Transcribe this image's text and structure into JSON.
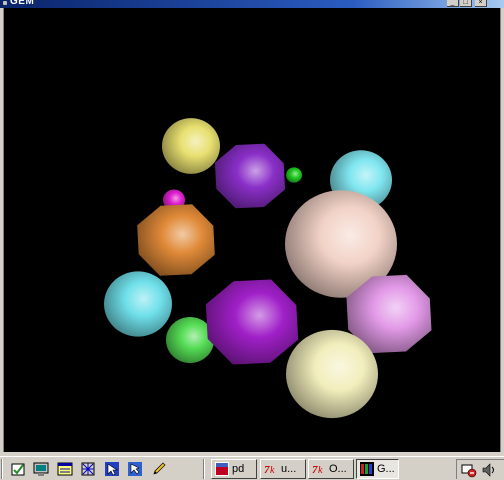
{
  "window": {
    "title": "GEM",
    "controls": [
      "minimize-icon",
      "maximize-icon",
      "close-icon"
    ]
  },
  "scene": {
    "background": "#000000",
    "objects": [
      {
        "shape": "sphere",
        "color": "#e8e070"
      },
      {
        "shape": "polyhedron",
        "color": "#8a2fc8"
      },
      {
        "shape": "sphere",
        "color": "#22cc22"
      },
      {
        "shape": "sphere",
        "color": "#7fe6f0"
      },
      {
        "shape": "sphere",
        "color": "#e020d0"
      },
      {
        "shape": "polyhedron",
        "color": "#e08a38"
      },
      {
        "shape": "sphere",
        "color": "#f2d2c6"
      },
      {
        "shape": "sphere",
        "color": "#6fe0ea"
      },
      {
        "shape": "sphere",
        "color": "#55dd55"
      },
      {
        "shape": "polyhedron",
        "color": "#a020c8"
      },
      {
        "shape": "polyhedron",
        "color": "#e39ae8"
      },
      {
        "shape": "sphere",
        "color": "#f2eebc"
      }
    ]
  },
  "taskbar": {
    "quick_launch": [
      "show-desktop-icon",
      "desktop-icon",
      "calendar-icon",
      "network-icon",
      "cursor-icon",
      "pencil-icon"
    ],
    "tasks": [
      {
        "icon": "pd-app-icon",
        "label": "pd",
        "active": false
      },
      {
        "icon": "editor-app-icon",
        "label": "u...",
        "active": false
      },
      {
        "icon": "editor-app-icon",
        "label": "O...",
        "active": false
      },
      {
        "icon": "gem-app-icon",
        "label": "G...",
        "active": true
      }
    ],
    "tray_icons": [
      "network-tray-icon",
      "volume-tray-icon"
    ]
  }
}
